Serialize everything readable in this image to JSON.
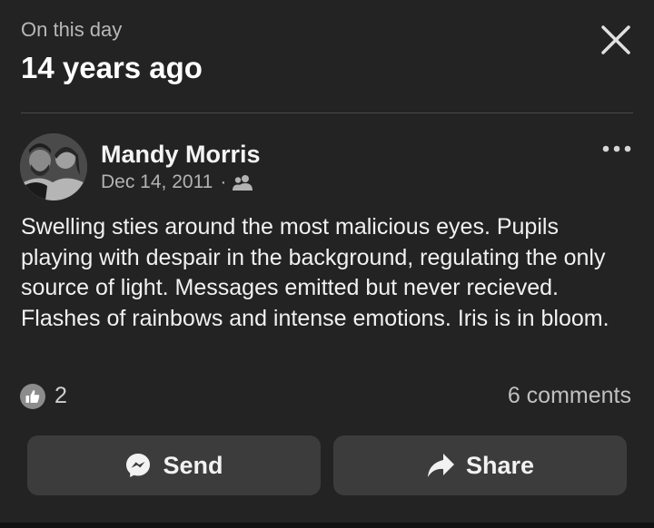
{
  "header": {
    "subtitle": "On this day",
    "title": "14 years ago"
  },
  "post": {
    "author": "Mandy Morris",
    "date": "Dec 14, 2011",
    "separator": "·",
    "audience_icon": "friends-icon",
    "text": "Swelling sties around the most malicious eyes. Pupils playing with despair in the background, regulating the only source of light. Messages emitted but never recieved. Flashes of rainbows and intense emotions. Iris is in bloom.",
    "reactions": {
      "icon": "like-icon",
      "count": "2"
    },
    "comments_label": "6 comments"
  },
  "actions": {
    "send_label": "Send",
    "share_label": "Share"
  },
  "colors": {
    "background": "#232323",
    "button": "#3c3c3c",
    "text_primary": "#f1f1f1",
    "text_secondary": "#b3b3b3"
  }
}
